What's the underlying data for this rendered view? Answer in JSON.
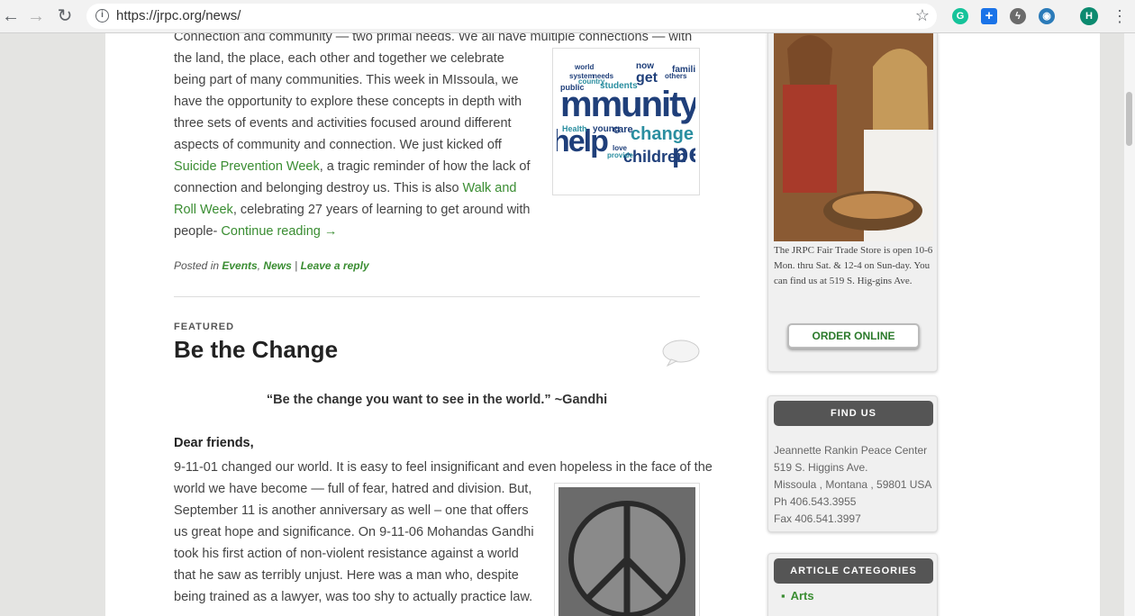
{
  "browser": {
    "url": "https://jrpc.org/news/",
    "avatar_letter": "H",
    "extensions": [
      "grammarly-icon",
      "plus-icon",
      "bolt-icon",
      "eye-icon"
    ]
  },
  "post1": {
    "lines": [
      "Connection and community — two primal needs. We all have multiple connections — with",
      "the land, the place, each other and together we celebrate",
      "being part of many communities. This week in MIssoula, we",
      "have the opportunity to explore these concepts in depth with",
      "three sets of events and activities focused around different",
      "aspects of community and connection. We just kicked off"
    ],
    "link_suicide": "Suicide Prevention Week",
    "after_suicide": ", a tragic reminder of how the lack of",
    "line_connection": "connection and belonging destroy us. This is also ",
    "link_walk1": "Walk and",
    "link_walk2": "Roll Week",
    "after_walk": ", celebrating 27 years of learning to get around with",
    "people": "people- ",
    "continue": "Continue reading →",
    "meta_posted": "Posted in ",
    "meta_events": "Events",
    "meta_comma": ", ",
    "meta_news": "News",
    "meta_sep": " | ",
    "meta_reply": "Leave a reply",
    "wordcloud_words": [
      "mmunity",
      "change",
      "children",
      "help",
      "students",
      "get",
      "world",
      "young",
      "Health",
      "care",
      "families",
      "others",
      "love",
      "public",
      "system",
      "needs",
      "country",
      "now",
      "provide",
      "pe"
    ]
  },
  "post2": {
    "kicker": "FEATURED",
    "title": "Be the Change",
    "quote": "“Be the change you want to see in the world.” ~Gandhi",
    "greeting": "Dear friends,",
    "lines": [
      "9-11-01 changed our world. It is easy to feel insignificant and even hopeless in the face of the",
      "world we have become — full of fear, hatred and division. But,",
      "September 11 is another anniversary as well – one that offers",
      "us great hope and significance. On 9-11-06 Mohandas Gandhi",
      "took his first action of non-violent resistance against a world",
      "that he saw as terribly unjust. Here was a man who, despite",
      "being trained as a lawyer, was too shy to actually practice law."
    ]
  },
  "sidebar": {
    "store_caption": "The JRPC Fair Trade Store is open 10-6 Mon. thru Sat. & 12-4 on Sun-day. You can find us at 519 S. Hig-gins Ave.",
    "order_button": "ORDER ONLINE",
    "find_header": "FIND US",
    "address": [
      "Jeannette Rankin Peace Center",
      "519 S. Higgins Ave.",
      "Missoula , Montana , 59801 USA",
      "Ph 406.543.3955",
      "Fax 406.541.3997"
    ],
    "cats_header": "ARTICLE CATEGORIES",
    "categories": [
      "Arts"
    ]
  }
}
